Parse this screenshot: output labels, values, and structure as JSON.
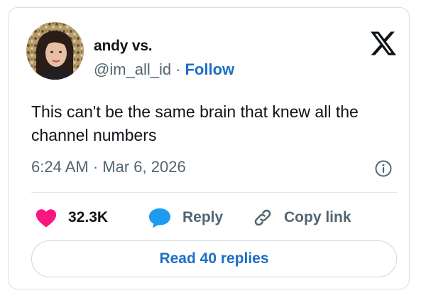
{
  "author": {
    "name": "andy vs.",
    "handle": "@im_all_id",
    "separator": "·",
    "follow_label": "Follow"
  },
  "tweet": {
    "text": "This can't be the same brain that knew all the channel numbers",
    "time": "6:24 AM",
    "separator": "·",
    "date": "Mar 6, 2026"
  },
  "actions": {
    "likes_count": "32.3K",
    "reply_label": "Reply",
    "copy_link_label": "Copy link"
  },
  "read_replies_label": "Read 40 replies",
  "icons": {
    "logo": "x-logo-icon",
    "info": "info-icon",
    "like": "heart-icon",
    "reply": "speech-bubble-icon",
    "copy": "link-icon"
  },
  "colors": {
    "accent": "#1d6fc4",
    "heart": "#f91880",
    "reply_bubble": "#1d9bf0",
    "muted_text": "#536471",
    "text": "#0f1419",
    "border": "#d9dee3"
  }
}
